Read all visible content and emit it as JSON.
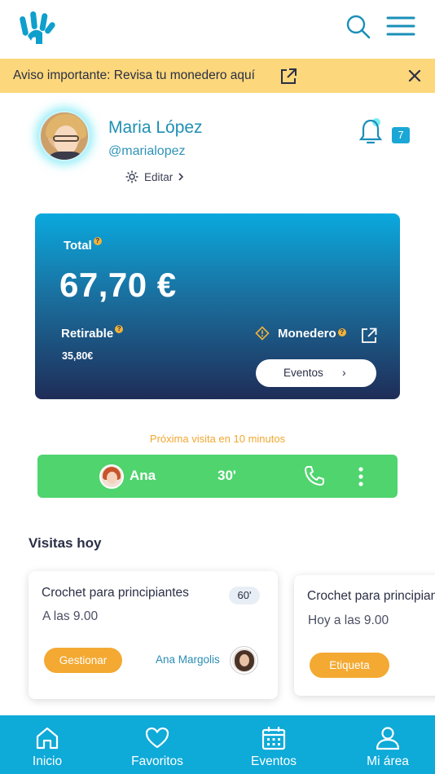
{
  "colors": {
    "brand": "#0eaad8",
    "notice_bg": "#fcd77b",
    "visit_green": "#4fd46e",
    "accent_orange": "#f3a932",
    "link_blue": "#1f8fb4"
  },
  "header": {
    "logo_icon": "hand-logo-icon",
    "search_icon": "search-icon",
    "menu_icon": "hamburger-menu-icon"
  },
  "notice": {
    "text": "Aviso importante: Revisa tu monedero aquí",
    "link_icon": "external-link-icon",
    "close_icon": "close-icon"
  },
  "profile": {
    "name": "Maria López",
    "handle": "@marialopez",
    "edit_label": "Editar",
    "notifications_count": "7"
  },
  "balance": {
    "total_label": "Total",
    "total_amount": "67,70 €",
    "withdrawable_label": "Retirable",
    "withdrawable_amount": "35,80€",
    "wallet_label": "Monedero",
    "events_button": "Eventos",
    "help_mark": "?"
  },
  "next_visit": {
    "text": "Próxima visita en 10 minutos",
    "person": "Ana",
    "duration": "30'"
  },
  "visits_today": {
    "title": "Visitas hoy",
    "cards": [
      {
        "title": "Crochet para principiantes",
        "time": "A las 9.00",
        "duration": "60'",
        "button": "Gestionar",
        "host": "Ana Margolis"
      },
      {
        "title": "Crochet para principiantes",
        "time": "Hoy a las 9.00",
        "button": "Etiqueta"
      }
    ]
  },
  "bottom_nav": {
    "items": [
      {
        "label": "Inicio",
        "icon": "home-icon"
      },
      {
        "label": "Favoritos",
        "icon": "heart-icon"
      },
      {
        "label": "Eventos",
        "icon": "calendar-icon"
      },
      {
        "label": "Mi área",
        "icon": "user-icon"
      }
    ]
  }
}
